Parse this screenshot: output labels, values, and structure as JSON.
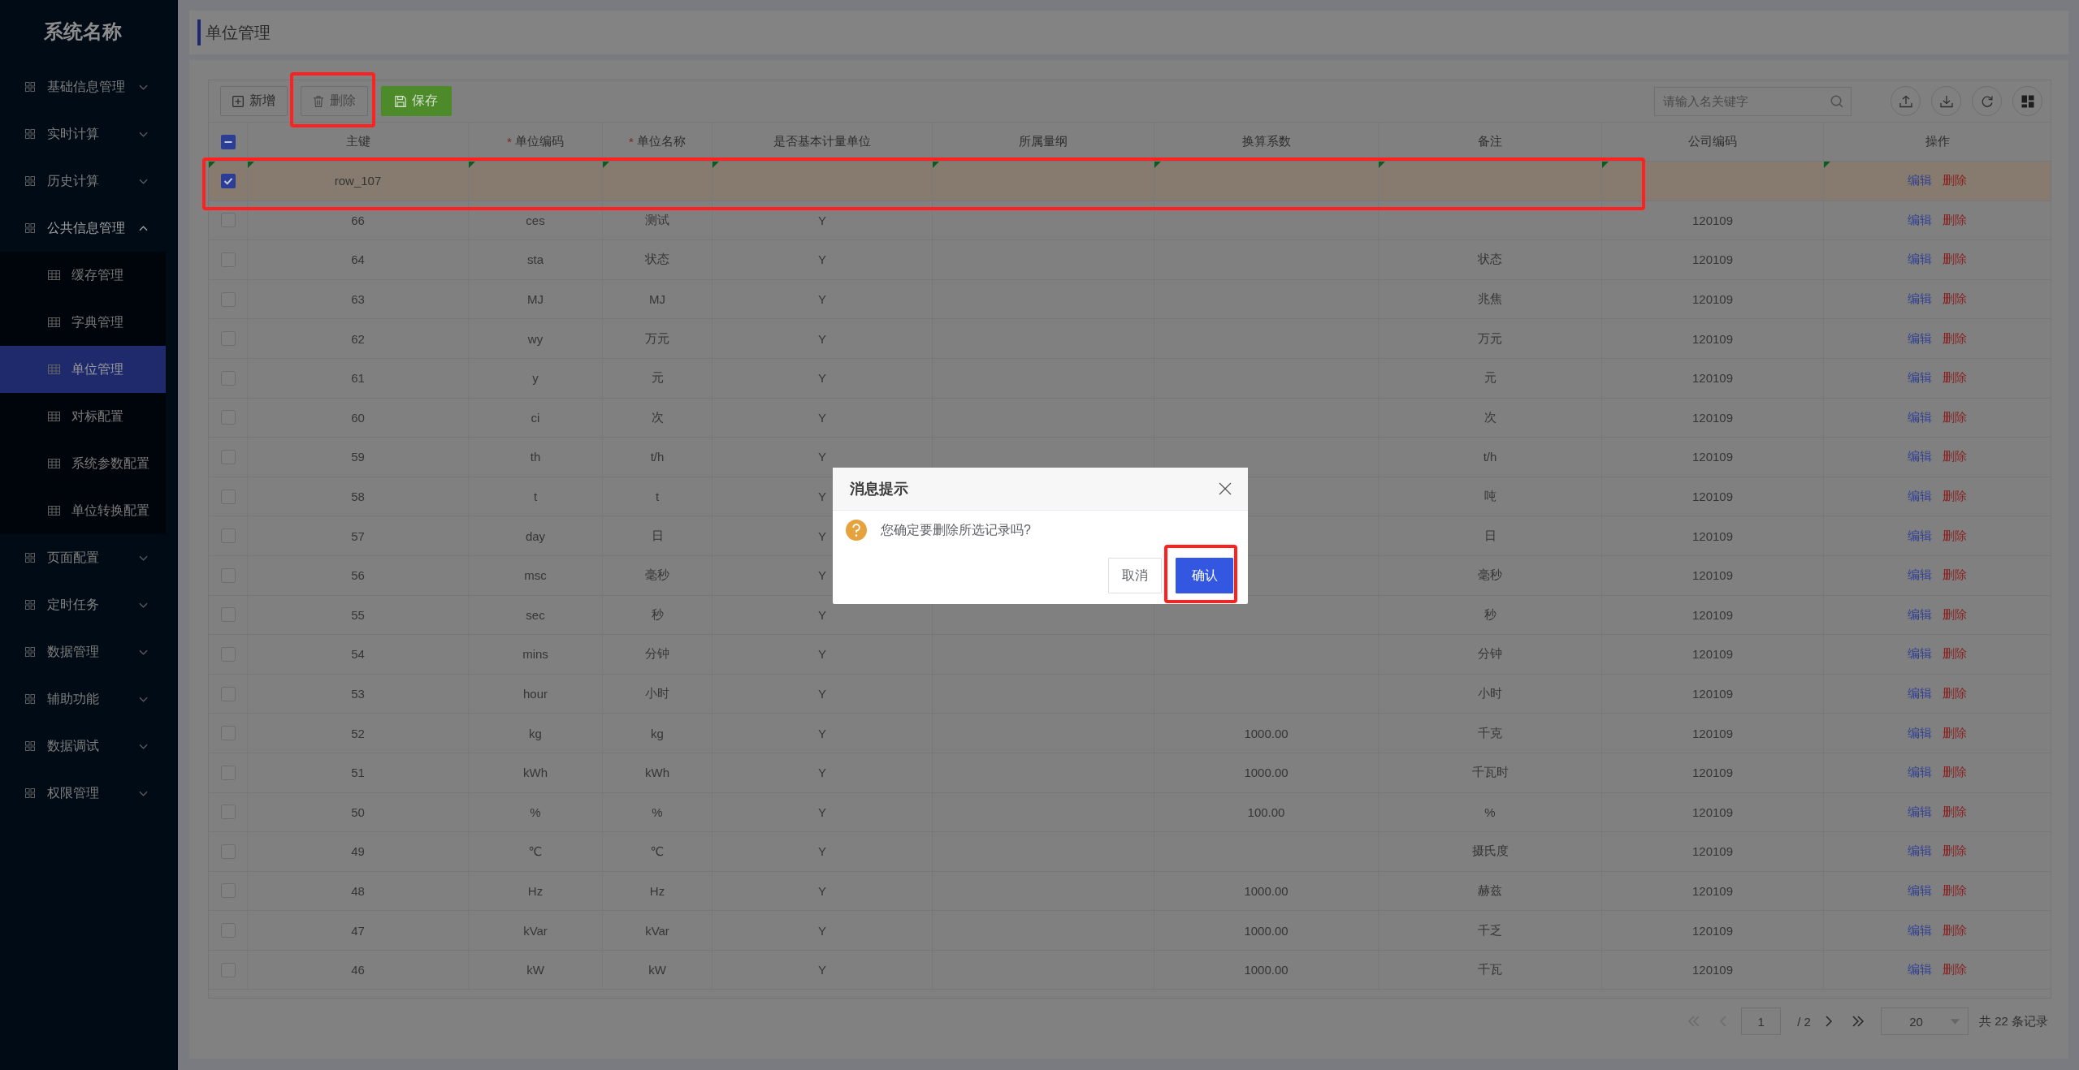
{
  "sidebar": {
    "title": "系统名称",
    "items": [
      {
        "label": "基础信息管理",
        "expanded": false
      },
      {
        "label": "实时计算",
        "expanded": false
      },
      {
        "label": "历史计算",
        "expanded": false
      },
      {
        "label": "公共信息管理",
        "expanded": true,
        "children": [
          {
            "label": "缓存管理",
            "selected": false
          },
          {
            "label": "字典管理",
            "selected": false
          },
          {
            "label": "单位管理",
            "selected": true
          },
          {
            "label": "对标配置",
            "selected": false
          },
          {
            "label": "系统参数配置",
            "selected": false
          },
          {
            "label": "单位转换配置",
            "selected": false
          }
        ]
      },
      {
        "label": "页面配置",
        "expanded": false
      },
      {
        "label": "定时任务",
        "expanded": false
      },
      {
        "label": "数据管理",
        "expanded": false
      },
      {
        "label": "辅助功能",
        "expanded": false
      },
      {
        "label": "数据调试",
        "expanded": false
      },
      {
        "label": "权限管理",
        "expanded": false
      }
    ]
  },
  "page_header": {
    "title": "单位管理"
  },
  "toolbar": {
    "buttons": [
      {
        "label": "新增",
        "kind": "add"
      },
      {
        "label": "删除",
        "kind": "delete",
        "highlighted": true
      },
      {
        "label": "保存",
        "kind": "save"
      }
    ],
    "search": {
      "placeholder": "请输入名关键字"
    },
    "icon_buttons": [
      {
        "kind": "upload"
      },
      {
        "kind": "download"
      },
      {
        "kind": "refresh"
      },
      {
        "kind": "layout"
      }
    ]
  },
  "table": {
    "select_all": {
      "indeterminate": true
    },
    "columns": [
      {
        "label": "主键"
      },
      {
        "label": "单位编码",
        "required_mark": "*"
      },
      {
        "label": "单位名称",
        "required_mark": "*"
      },
      {
        "label": "是否基本计量单位"
      },
      {
        "label": "所属量纲"
      },
      {
        "label": "换算系数"
      },
      {
        "label": "备注"
      },
      {
        "label": "公司编码"
      },
      {
        "label": "操作"
      }
    ],
    "rows": [
      {
        "selected": true,
        "edited": true,
        "highlighted": true,
        "cells": [
          "row_107",
          null,
          null,
          null,
          null,
          null,
          null,
          null
        ],
        "actions": [
          "编辑",
          "删除"
        ]
      },
      {
        "selected": false,
        "edited": false,
        "highlighted": false,
        "cells": [
          "66",
          "ces",
          "测试",
          "Y",
          null,
          null,
          null,
          "120109"
        ],
        "actions": [
          "编辑",
          "删除"
        ]
      },
      {
        "selected": false,
        "edited": false,
        "highlighted": false,
        "cells": [
          "64",
          "sta",
          "状态",
          "Y",
          null,
          null,
          "状态",
          "120109"
        ],
        "actions": [
          "编辑",
          "删除"
        ]
      },
      {
        "selected": false,
        "edited": false,
        "highlighted": false,
        "cells": [
          "63",
          "MJ",
          "MJ",
          "Y",
          null,
          null,
          "兆焦",
          "120109"
        ],
        "actions": [
          "编辑",
          "删除"
        ]
      },
      {
        "selected": false,
        "edited": false,
        "highlighted": false,
        "cells": [
          "62",
          "wy",
          "万元",
          "Y",
          null,
          null,
          "万元",
          "120109"
        ],
        "actions": [
          "编辑",
          "删除"
        ]
      },
      {
        "selected": false,
        "edited": false,
        "highlighted": false,
        "cells": [
          "61",
          "y",
          "元",
          "Y",
          null,
          null,
          "元",
          "120109"
        ],
        "actions": [
          "编辑",
          "删除"
        ]
      },
      {
        "selected": false,
        "edited": false,
        "highlighted": false,
        "cells": [
          "60",
          "ci",
          "次",
          "Y",
          null,
          null,
          "次",
          "120109"
        ],
        "actions": [
          "编辑",
          "删除"
        ]
      },
      {
        "selected": false,
        "edited": false,
        "highlighted": false,
        "cells": [
          "59",
          "th",
          "t/h",
          "Y",
          null,
          null,
          "t/h",
          "120109"
        ],
        "actions": [
          "编辑",
          "删除"
        ]
      },
      {
        "selected": false,
        "edited": false,
        "highlighted": false,
        "cells": [
          "58",
          "t",
          "t",
          "Y",
          null,
          null,
          "吨",
          "120109"
        ],
        "actions": [
          "编辑",
          "删除"
        ]
      },
      {
        "selected": false,
        "edited": false,
        "highlighted": false,
        "cells": [
          "57",
          "day",
          "日",
          "Y",
          null,
          null,
          "日",
          "120109"
        ],
        "actions": [
          "编辑",
          "删除"
        ]
      },
      {
        "selected": false,
        "edited": false,
        "highlighted": false,
        "cells": [
          "56",
          "msc",
          "毫秒",
          "Y",
          null,
          null,
          "毫秒",
          "120109"
        ],
        "actions": [
          "编辑",
          "删除"
        ]
      },
      {
        "selected": false,
        "edited": false,
        "highlighted": false,
        "cells": [
          "55",
          "sec",
          "秒",
          "Y",
          null,
          null,
          "秒",
          "120109"
        ],
        "actions": [
          "编辑",
          "删除"
        ]
      },
      {
        "selected": false,
        "edited": false,
        "highlighted": false,
        "cells": [
          "54",
          "mins",
          "分钟",
          "Y",
          null,
          null,
          "分钟",
          "120109"
        ],
        "actions": [
          "编辑",
          "删除"
        ]
      },
      {
        "selected": false,
        "edited": false,
        "highlighted": false,
        "cells": [
          "53",
          "hour",
          "小时",
          "Y",
          null,
          null,
          "小时",
          "120109"
        ],
        "actions": [
          "编辑",
          "删除"
        ]
      },
      {
        "selected": false,
        "edited": false,
        "highlighted": false,
        "cells": [
          "52",
          "kg",
          "kg",
          "Y",
          null,
          "1000.00",
          "千克",
          "120109"
        ],
        "actions": [
          "编辑",
          "删除"
        ]
      },
      {
        "selected": false,
        "edited": false,
        "highlighted": false,
        "cells": [
          "51",
          "kWh",
          "kWh",
          "Y",
          null,
          "1000.00",
          "千瓦时",
          "120109"
        ],
        "actions": [
          "编辑",
          "删除"
        ]
      },
      {
        "selected": false,
        "edited": false,
        "highlighted": false,
        "cells": [
          "50",
          "%",
          "%",
          "Y",
          null,
          "100.00",
          "%",
          "120109"
        ],
        "actions": [
          "编辑",
          "删除"
        ]
      },
      {
        "selected": false,
        "edited": false,
        "highlighted": false,
        "cells": [
          "49",
          "℃",
          "℃",
          "Y",
          null,
          null,
          "摄氏度",
          "120109"
        ],
        "actions": [
          "编辑",
          "删除"
        ]
      },
      {
        "selected": false,
        "edited": false,
        "highlighted": false,
        "cells": [
          "48",
          "Hz",
          "Hz",
          "Y",
          null,
          "1000.00",
          "赫兹",
          "120109"
        ],
        "actions": [
          "编辑",
          "删除"
        ]
      },
      {
        "selected": false,
        "edited": false,
        "highlighted": false,
        "cells": [
          "47",
          "kVar",
          "kVar",
          "Y",
          null,
          "1000.00",
          "千乏",
          "120109"
        ],
        "actions": [
          "编辑",
          "删除"
        ]
      },
      {
        "selected": false,
        "edited": false,
        "highlighted": false,
        "cells": [
          "46",
          "kW",
          "kW",
          "Y",
          null,
          "1000.00",
          "千瓦",
          "120109"
        ],
        "actions": [
          "编辑",
          "删除"
        ]
      }
    ]
  },
  "pagination": {
    "nav": [
      {
        "kind": "first",
        "disabled": true
      },
      {
        "kind": "prev",
        "disabled": true
      },
      {
        "kind": "next",
        "disabled": false
      },
      {
        "kind": "last",
        "disabled": false
      }
    ],
    "page": "1",
    "total_pages": "/ 2",
    "page_size": "20",
    "total": "共 22 条记录"
  },
  "dialog": {
    "title": "消息提示",
    "message": "您确定要删除所选记录吗?",
    "buttons": [
      {
        "label": "取消",
        "kind": "plain"
      },
      {
        "label": "确认",
        "kind": "primary",
        "highlighted": true
      }
    ]
  }
}
